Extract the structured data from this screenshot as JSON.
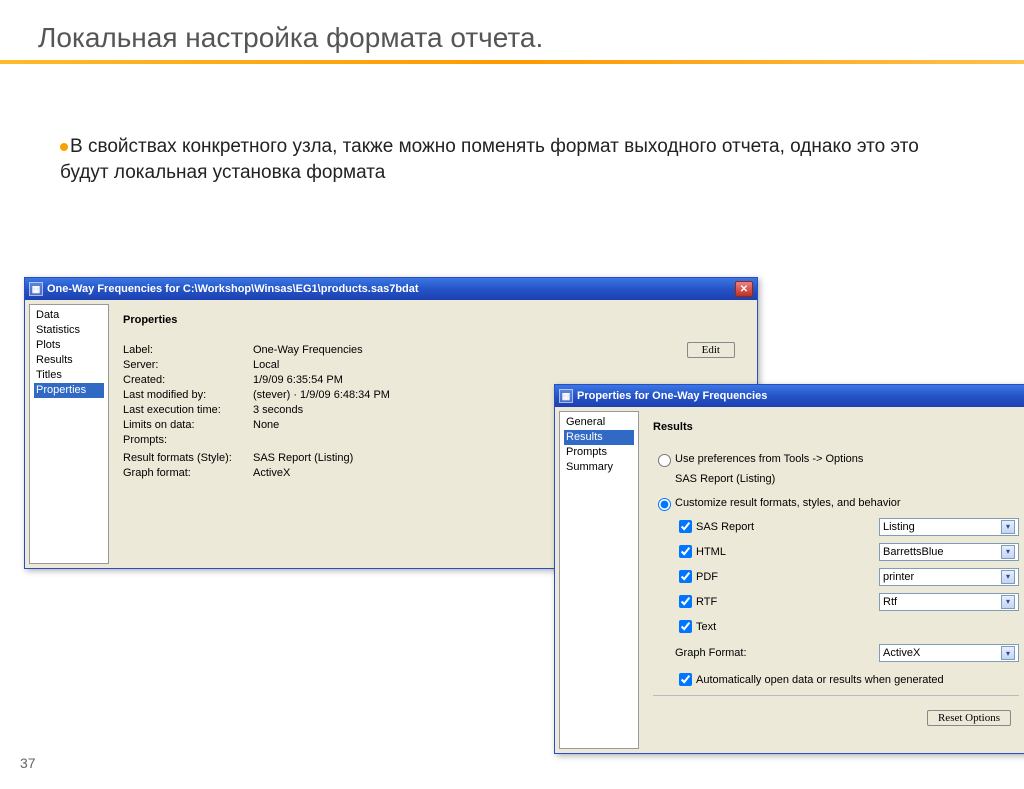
{
  "slide": {
    "title": "Локальная настройка формата отчета.",
    "bullet": "В свойствах конкретного узла, также можно поменять формат выходного отчета, однако это это будут локальная установка формата",
    "page_number": "37"
  },
  "win1": {
    "title": "One-Way Frequencies for C:\\Workshop\\Winsas\\EG1\\products.sas7bdat",
    "side_items": [
      "Data",
      "Statistics",
      "Plots",
      "Results",
      "Titles",
      "Properties"
    ],
    "side_selected": 5,
    "heading": "Properties",
    "edit_label": "Edit",
    "rows": [
      {
        "label": "Label:",
        "value": "One-Way Frequencies"
      },
      {
        "label": "Server:",
        "value": "Local"
      },
      {
        "label": "Created:",
        "value": "1/9/09 6:35:54 PM"
      },
      {
        "label": "Last modified by:",
        "value": "(stever) · 1/9/09 6:48:34 PM"
      },
      {
        "label": "Last execution time:",
        "value": "3 seconds"
      },
      {
        "label": "Limits on data:",
        "value": "None"
      },
      {
        "label": "Prompts:",
        "value": ""
      },
      {
        "label": "",
        "value": ""
      },
      {
        "label": "Result formats (Style):",
        "value": "SAS Report (Listing)"
      },
      {
        "label": "Graph format:",
        "value": "ActiveX"
      }
    ]
  },
  "win2": {
    "title": "Properties for One-Way Frequencies",
    "side_items": [
      "General",
      "Results",
      "Prompts",
      "Summary"
    ],
    "side_selected": 1,
    "heading": "Results",
    "radio_prefs": "Use preferences from Tools -> Options",
    "prefs_sub": "SAS Report (Listing)",
    "radio_custom": "Customize result formats, styles, and behavior",
    "formats": [
      {
        "label": "SAS Report",
        "value": "Listing",
        "checked": true
      },
      {
        "label": "HTML",
        "value": "BarrettsBlue",
        "checked": true
      },
      {
        "label": "PDF",
        "value": "printer",
        "checked": true
      },
      {
        "label": "RTF",
        "value": "Rtf",
        "checked": true
      },
      {
        "label": "Text",
        "value": "",
        "checked": true
      }
    ],
    "graph_format_label": "Graph Format:",
    "graph_format_value": "ActiveX",
    "auto_open": "Automatically open data or results when generated",
    "reset_label": "Reset Options"
  }
}
